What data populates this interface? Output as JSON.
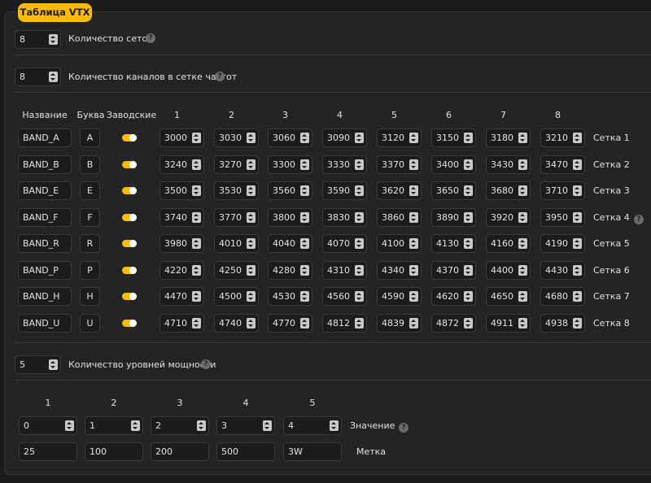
{
  "tab_title": "Таблица VTX",
  "bands_count": {
    "value": "8",
    "label": "Количество сеток"
  },
  "channels_count": {
    "value": "8",
    "label": "Количество каналов в сетке частот"
  },
  "table": {
    "headers": {
      "name": "Название",
      "letter": "Буква",
      "factory": "Заводские"
    },
    "channel_headers": [
      "1",
      "2",
      "3",
      "4",
      "5",
      "6",
      "7",
      "8"
    ],
    "rows": [
      {
        "name": "BAND_A",
        "letter": "A",
        "factory": true,
        "freqs": [
          "3000",
          "3030",
          "3060",
          "3090",
          "3120",
          "3150",
          "3180",
          "3210"
        ],
        "label": "Сетка 1"
      },
      {
        "name": "BAND_B",
        "letter": "B",
        "factory": true,
        "freqs": [
          "3240",
          "3270",
          "3300",
          "3330",
          "3370",
          "3400",
          "3430",
          "3470"
        ],
        "label": "Сетка 2"
      },
      {
        "name": "BAND_E",
        "letter": "E",
        "factory": true,
        "freqs": [
          "3500",
          "3530",
          "3560",
          "3590",
          "3620",
          "3650",
          "3680",
          "3710"
        ],
        "label": "Сетка 3"
      },
      {
        "name": "BAND_F",
        "letter": "F",
        "factory": true,
        "freqs": [
          "3740",
          "3770",
          "3800",
          "3830",
          "3860",
          "3890",
          "3920",
          "3950"
        ],
        "label": "Сетка 4"
      },
      {
        "name": "BAND_R",
        "letter": "R",
        "factory": true,
        "freqs": [
          "3980",
          "4010",
          "4040",
          "4070",
          "4100",
          "4130",
          "4160",
          "4190"
        ],
        "label": "Сетка 5"
      },
      {
        "name": "BAND_P",
        "letter": "P",
        "factory": true,
        "freqs": [
          "4220",
          "4250",
          "4280",
          "4310",
          "4340",
          "4370",
          "4400",
          "4430"
        ],
        "label": "Сетка 6"
      },
      {
        "name": "BAND_H",
        "letter": "H",
        "factory": true,
        "freqs": [
          "4470",
          "4500",
          "4530",
          "4560",
          "4590",
          "4620",
          "4650",
          "4680"
        ],
        "label": "Сетка 7"
      },
      {
        "name": "BAND_U",
        "letter": "U",
        "factory": true,
        "freqs": [
          "4710",
          "4740",
          "4770",
          "4812",
          "4839",
          "4872",
          "4911",
          "4938"
        ],
        "label": "Сетка 8"
      }
    ]
  },
  "power_count": {
    "value": "5",
    "label": "Количество уровней мощности"
  },
  "power": {
    "headers": [
      "1",
      "2",
      "3",
      "4",
      "5"
    ],
    "values": [
      "0",
      "1",
      "2",
      "3",
      "4"
    ],
    "value_label": "Значение",
    "labels": [
      "25",
      "100",
      "200",
      "500",
      "3W"
    ],
    "label_label": "Метка"
  },
  "help_icon": "?",
  "colors": {
    "accent": "#ffbb00",
    "panel": "#242424",
    "background": "#1b1b1b"
  }
}
